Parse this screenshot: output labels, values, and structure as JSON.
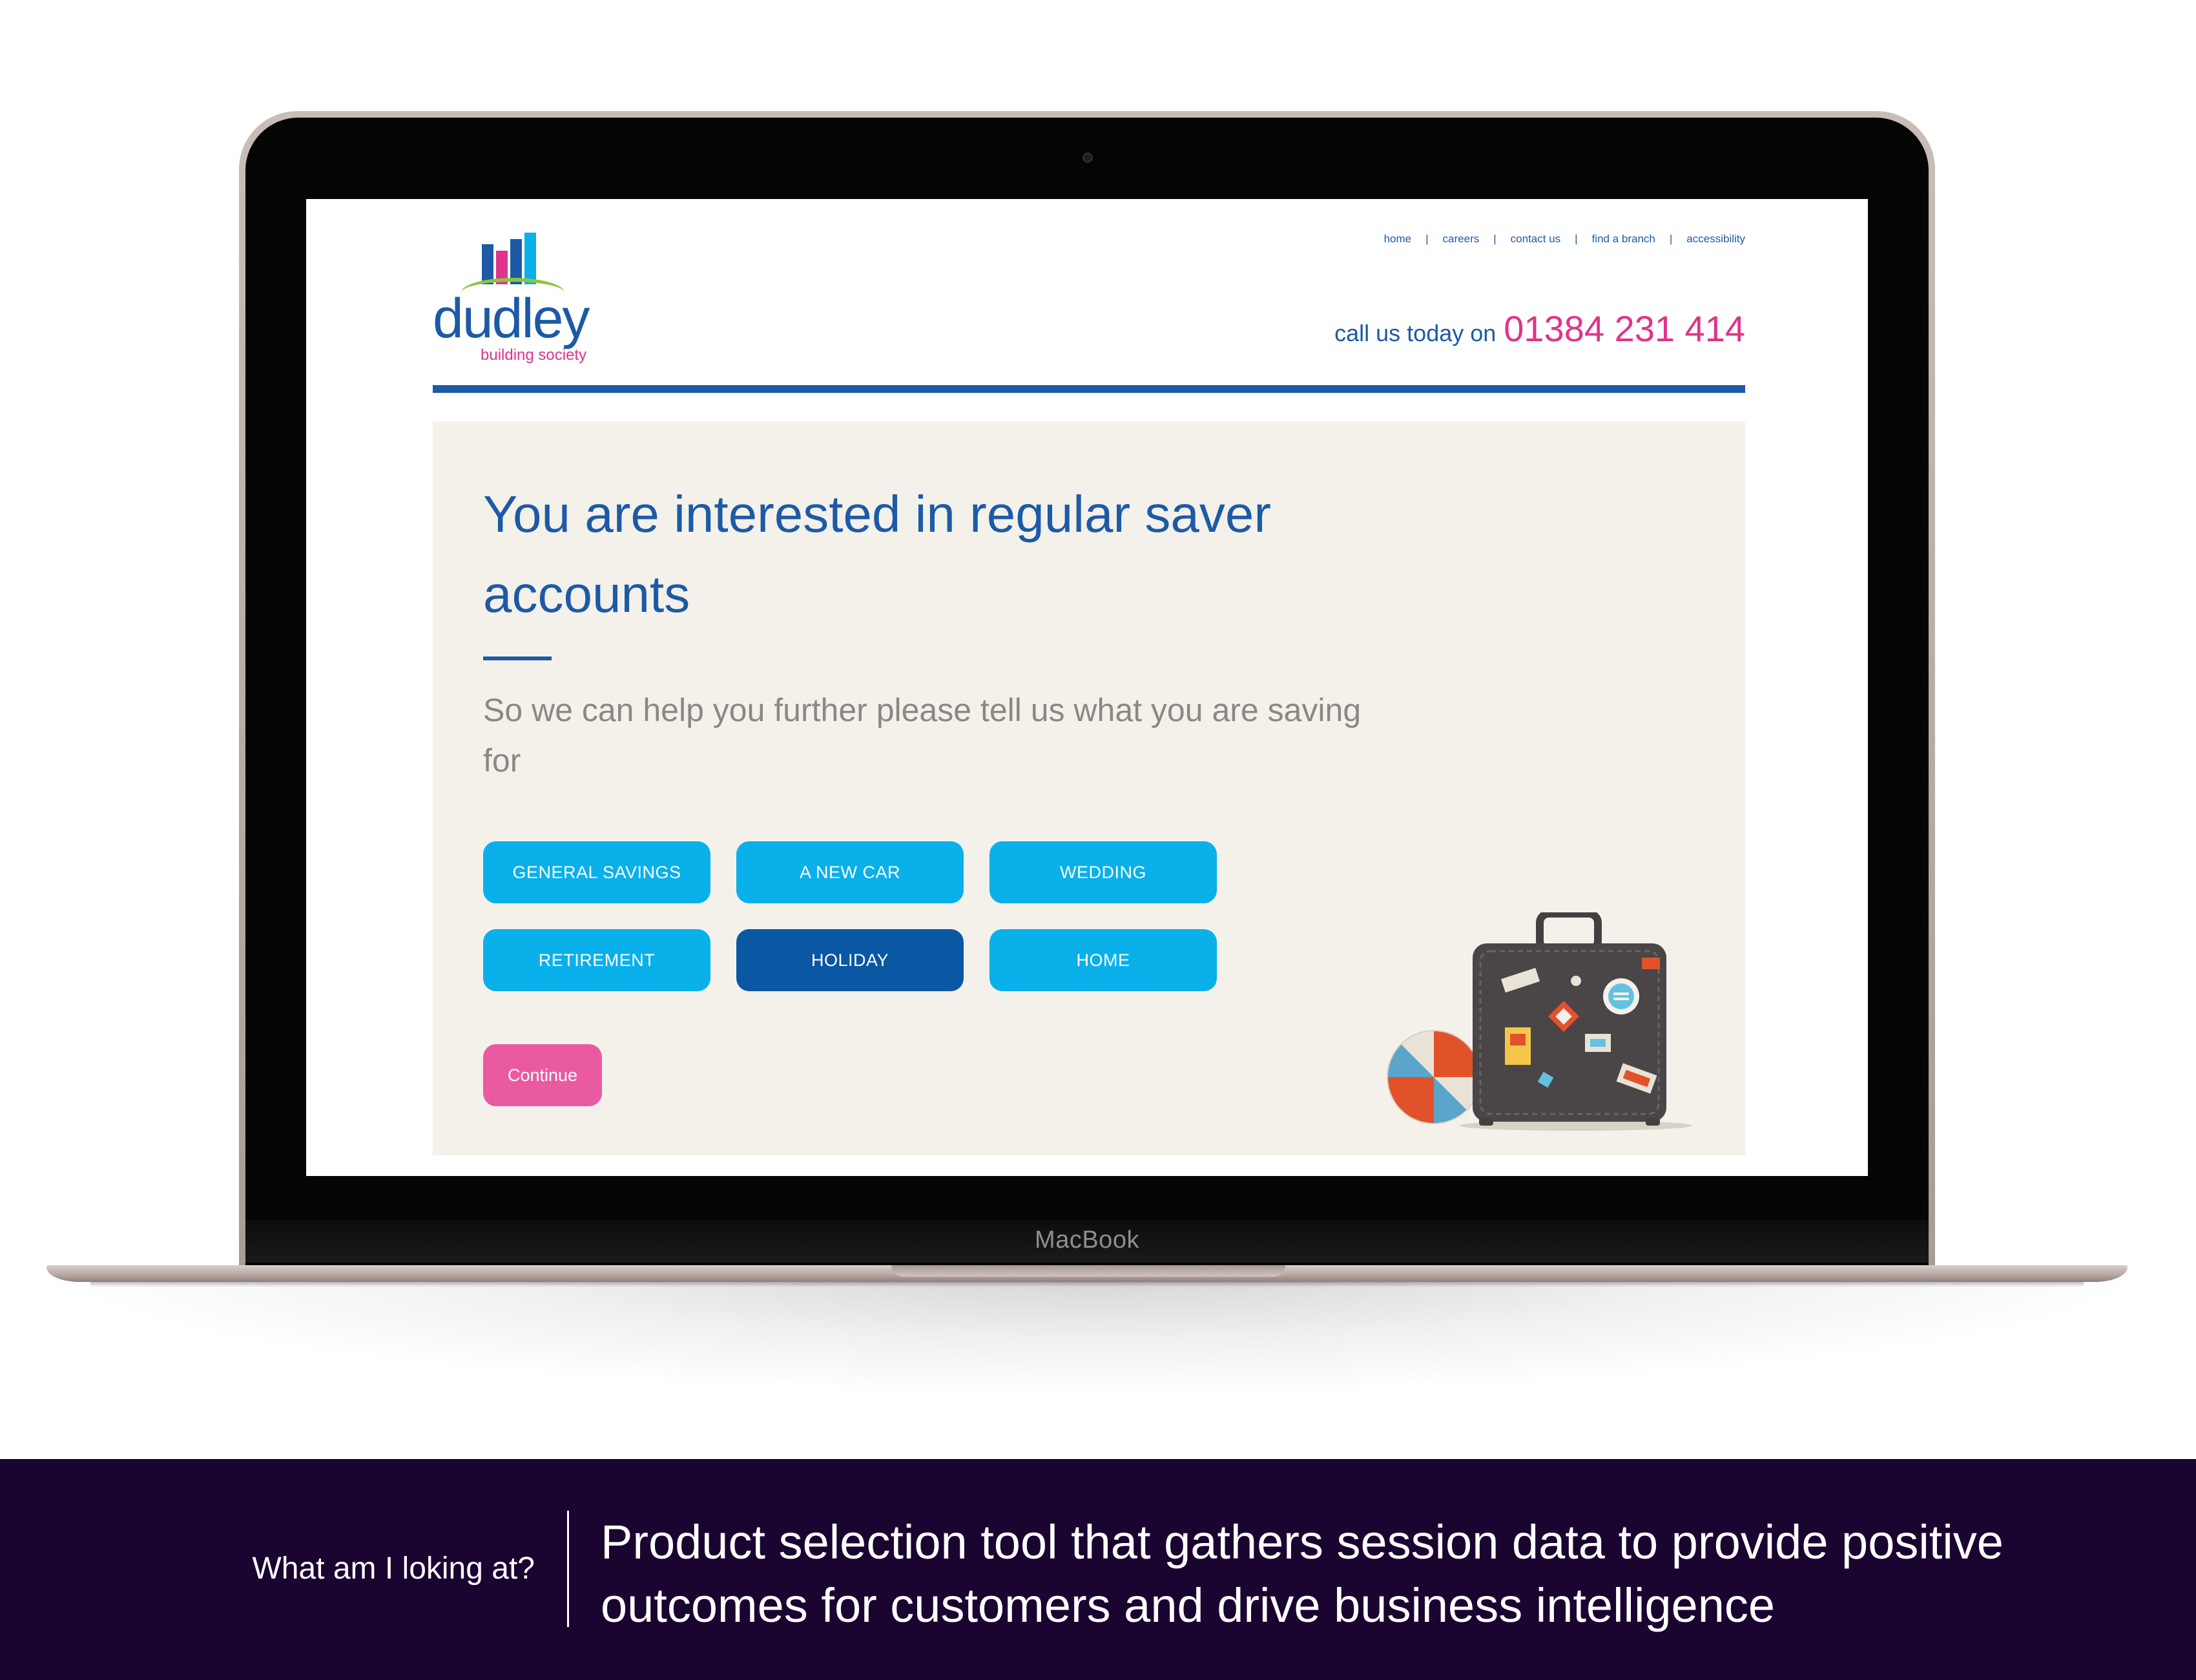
{
  "device": {
    "label": "MacBook"
  },
  "site": {
    "logo": {
      "word": "dudley",
      "subtitle": "building society"
    },
    "nav": [
      {
        "label": "home"
      },
      {
        "label": "careers"
      },
      {
        "label": "contact us"
      },
      {
        "label": "find a branch"
      },
      {
        "label": "accessibility"
      }
    ],
    "call": {
      "text": "call us today on",
      "number": "01384 231 414"
    }
  },
  "panel": {
    "title": "You are interested in regular saver accounts",
    "subtitle": "So we can help you further please tell us what you are saving for",
    "options": [
      {
        "label": "GENERAL SAVINGS",
        "selected": false
      },
      {
        "label": "A NEW CAR",
        "selected": false
      },
      {
        "label": "WEDDING",
        "selected": false
      },
      {
        "label": "RETIREMENT",
        "selected": false
      },
      {
        "label": "HOLIDAY",
        "selected": true
      },
      {
        "label": "HOME",
        "selected": false
      }
    ],
    "continue_label": "Continue",
    "illustration": [
      "beach-ball-icon",
      "suitcase-icon"
    ]
  },
  "caption": {
    "label": "What am I loking at?",
    "text": "Product selection tool that gathers session data to provide positive outcomes for customers and drive business intelligence"
  },
  "colors": {
    "brand_blue": "#1c5aa6",
    "brand_pink": "#e0338a",
    "option_blue": "#0ab0ea",
    "option_selected": "#0a57a4",
    "continue_pink": "#ea5aa0",
    "panel_bg": "#f4f1ea",
    "caption_bg": "#1a0430"
  }
}
